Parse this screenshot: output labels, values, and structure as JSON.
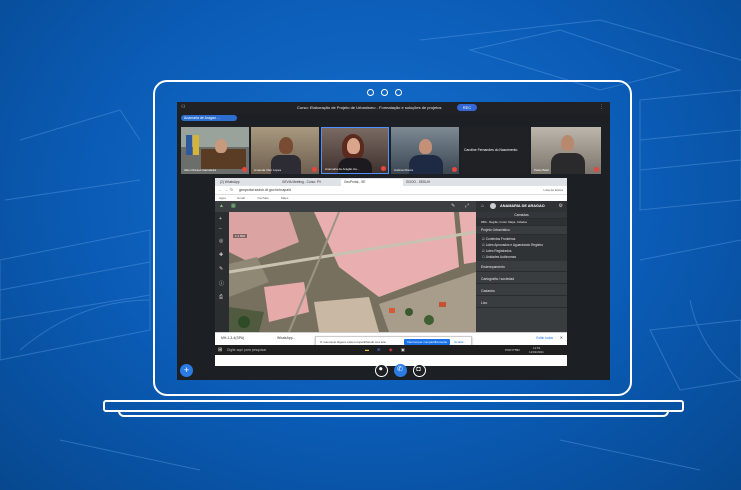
{
  "meeting": {
    "title": "Curso: Elaboração de Projeto de Urbanismo - Formatação e soluções de projetos",
    "rec_label": "REC",
    "presenter_chip": "Anamaria de Aragao ...",
    "participants": [
      {
        "name": "Allen Moraes Gameleira"
      },
      {
        "name": "Amanda Vitor Lopes"
      },
      {
        "name": "Anamaria de Aragão Go..."
      },
      {
        "name": "Andrea Moura"
      },
      {
        "name": "Caroline Fernandes do Nascimento"
      },
      {
        "name": "Paulo Batic"
      }
    ]
  },
  "browser": {
    "tabs": [
      {
        "label": "(2) WhatsApp"
      },
      {
        "label": "GEVIA Meeting - Curso: PV"
      },
      {
        "label": "GeoPortal - SE"
      },
      {
        "label": "GOOO - SEDUH"
      }
    ],
    "url": "geoportal.seduh.df.gov.br/mapa/#",
    "bookmarks": [
      "Apps",
      "Gmail",
      "YouTube",
      "Maps"
    ],
    "right_url_label": "Lista de leitura"
  },
  "geoportal": {
    "user_name": "ANAMARIA DE ARAGAO",
    "panel_header": "Camadas",
    "search_hint": "RBA - Região, Fonte: Mapa, Cidades",
    "sections": [
      {
        "label": "Projeto Urbanístico"
      },
      {
        "label": "Endereçamento"
      },
      {
        "label": "Cartografia / sociedad"
      },
      {
        "label": "Cadastro"
      },
      {
        "label": "Lixo"
      }
    ],
    "layers": [
      {
        "label": "Contextos Fronteiras"
      },
      {
        "label": "Lotes Aprovados e Aguardando Registro"
      },
      {
        "label": "Lotes Registrados"
      },
      {
        "label": "Unidades Autônomas"
      }
    ],
    "scale": "1:1 500"
  },
  "downloads": {
    "files": [
      {
        "name": "MH-1-3-4(SPA)"
      },
      {
        "name": "WhatsApp..."
      }
    ],
    "show_all": "Exibir todos"
  },
  "notification": {
    "text": "O manuseio.itlgeovi está compartilhando sua tela.",
    "stop_button": "Interromper compartilhamento",
    "hide_button": "Ocultar"
  },
  "taskbar": {
    "search_placeholder": "Digite aqui para pesquisar",
    "lang": "POR PTB2",
    "time": "11:51",
    "date": "11/01/2021"
  }
}
